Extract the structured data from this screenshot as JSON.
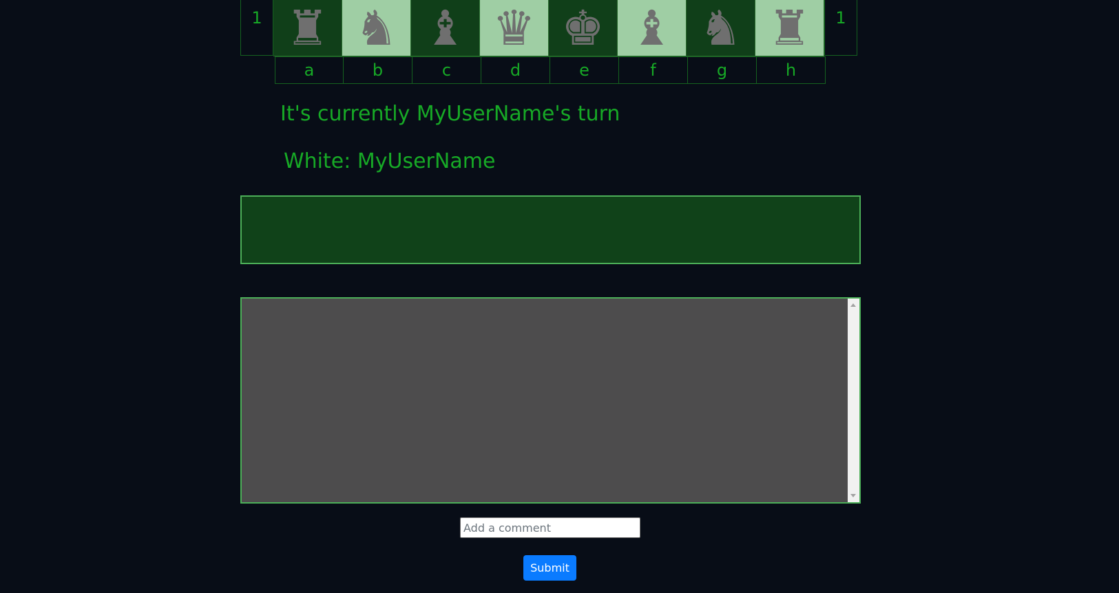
{
  "board": {
    "rank_left": "1",
    "rank_right": "1",
    "squares": [
      {
        "piece": "♜",
        "icon": "rook-icon"
      },
      {
        "piece": "♞",
        "icon": "knight-icon"
      },
      {
        "piece": "♝",
        "icon": "bishop-icon"
      },
      {
        "piece": "♛",
        "icon": "queen-icon"
      },
      {
        "piece": "♚",
        "icon": "king-icon"
      },
      {
        "piece": "♝",
        "icon": "bishop-icon"
      },
      {
        "piece": "♞",
        "icon": "knight-icon"
      },
      {
        "piece": "♜",
        "icon": "rook-icon"
      }
    ],
    "files": [
      "a",
      "b",
      "c",
      "d",
      "e",
      "f",
      "g",
      "h"
    ]
  },
  "status": {
    "turn_text": "It's currently MyUserName's turn",
    "white_player_text": "White: MyUserName"
  },
  "comment_form": {
    "placeholder": "Add a comment",
    "submit_label": "Submit"
  },
  "colors": {
    "background": "#080d17",
    "text_green": "#17a926",
    "dark_square": "#103f19",
    "light_square": "#9fcea4",
    "button_blue": "#0a7bff"
  }
}
